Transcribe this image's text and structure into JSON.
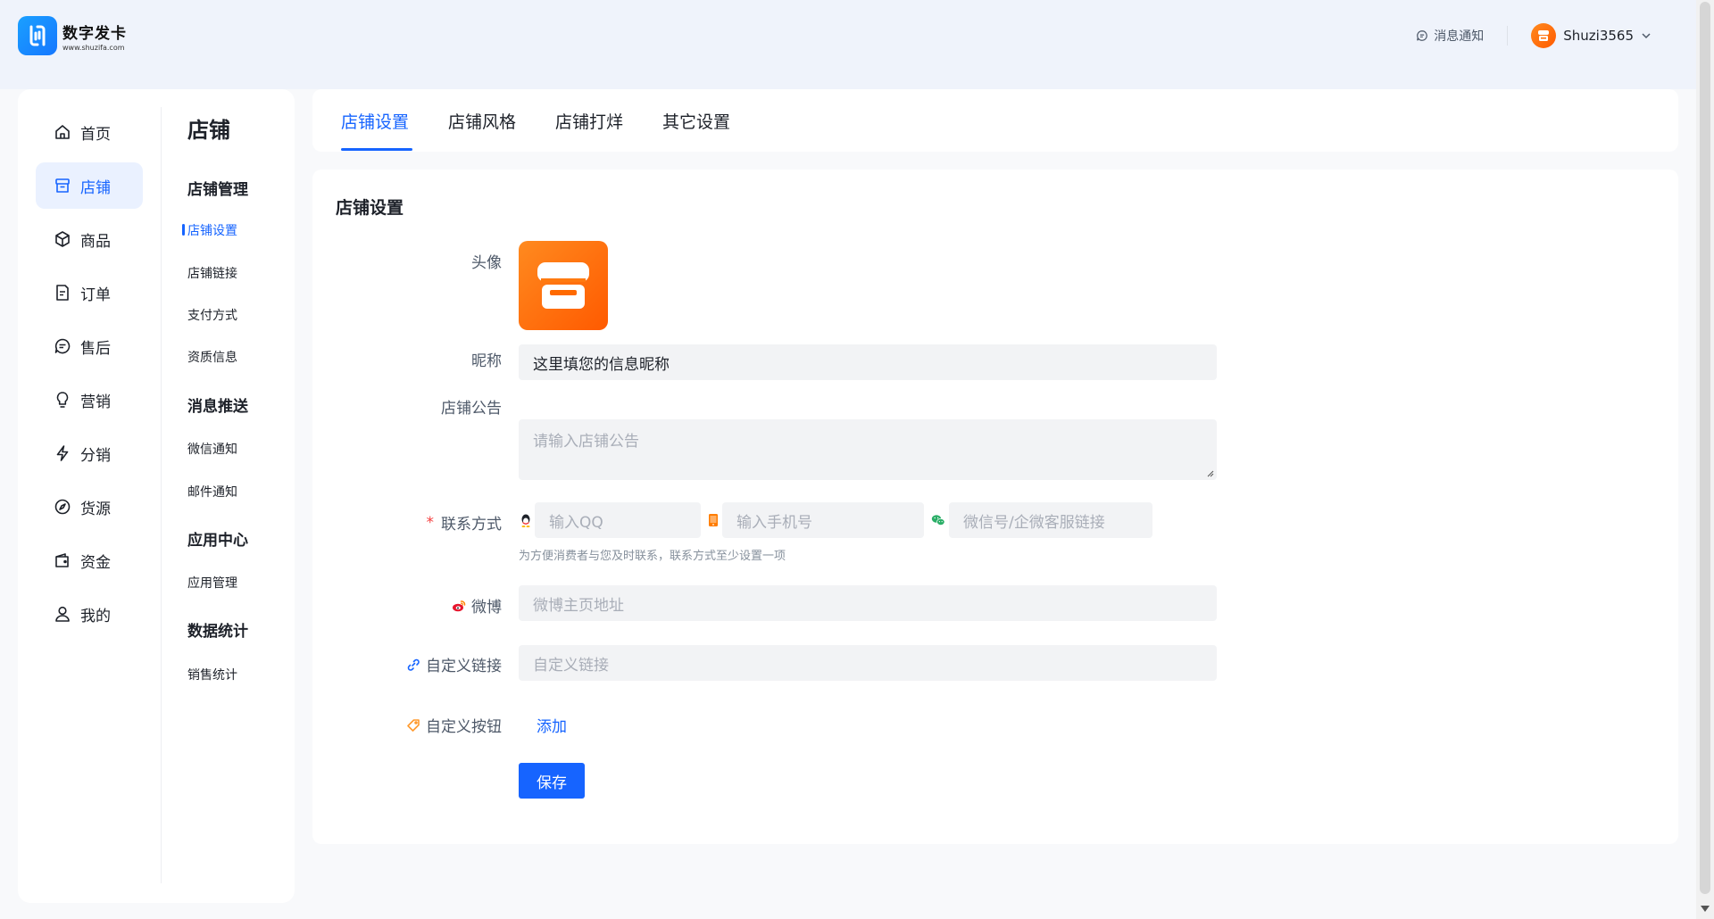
{
  "brand": {
    "name": "数字发卡",
    "url": "www.shuzifa.com",
    "accent": "#1664ff",
    "orange": "#ff6a00"
  },
  "header": {
    "notice_label": "消息通知",
    "username": "Shuzi3565"
  },
  "nav": {
    "items": [
      {
        "label": "首页",
        "icon": "home-icon"
      },
      {
        "label": "店铺",
        "icon": "store-icon",
        "active": true
      },
      {
        "label": "商品",
        "icon": "box-icon"
      },
      {
        "label": "订单",
        "icon": "order-icon"
      },
      {
        "label": "售后",
        "icon": "chat-icon"
      },
      {
        "label": "营销",
        "icon": "bulb-icon"
      },
      {
        "label": "分销",
        "icon": "lightning-icon"
      },
      {
        "label": "货源",
        "icon": "compass-icon"
      },
      {
        "label": "资金",
        "icon": "wallet-icon"
      },
      {
        "label": "我的",
        "icon": "user-icon"
      }
    ]
  },
  "submenu": {
    "title": "店铺",
    "groups": [
      {
        "title": "店铺管理",
        "items": [
          "店铺设置",
          "店铺链接",
          "支付方式",
          "资质信息"
        ]
      },
      {
        "title": "消息推送",
        "items": [
          "微信通知",
          "邮件通知"
        ]
      },
      {
        "title": "应用中心",
        "items": [
          "应用管理"
        ]
      },
      {
        "title": "数据统计",
        "items": [
          "销售统计"
        ]
      }
    ]
  },
  "tabs": [
    "店铺设置",
    "店铺风格",
    "店铺打烊",
    "其它设置"
  ],
  "form": {
    "section_title": "店铺设置",
    "avatar_label": "头像",
    "nickname_label": "昵称",
    "nickname_value": "这里填您的信息昵称",
    "notice_label": "店铺公告",
    "notice_placeholder": "请输入店铺公告",
    "contact_required": "*",
    "contact_label": "联系方式",
    "qq_placeholder": "输入QQ",
    "phone_placeholder": "输入手机号",
    "wechat_placeholder": "微信号/企微客服链接",
    "contact_hint": "为方便消费者与您及时联系，联系方式至少设置一项",
    "weibo_label": "微博",
    "weibo_placeholder": "微博主页地址",
    "custom_link_label": "自定义链接",
    "custom_link_placeholder": "自定义链接",
    "custom_button_label": "自定义按钮",
    "add_label": "添加",
    "save_label": "保存"
  }
}
